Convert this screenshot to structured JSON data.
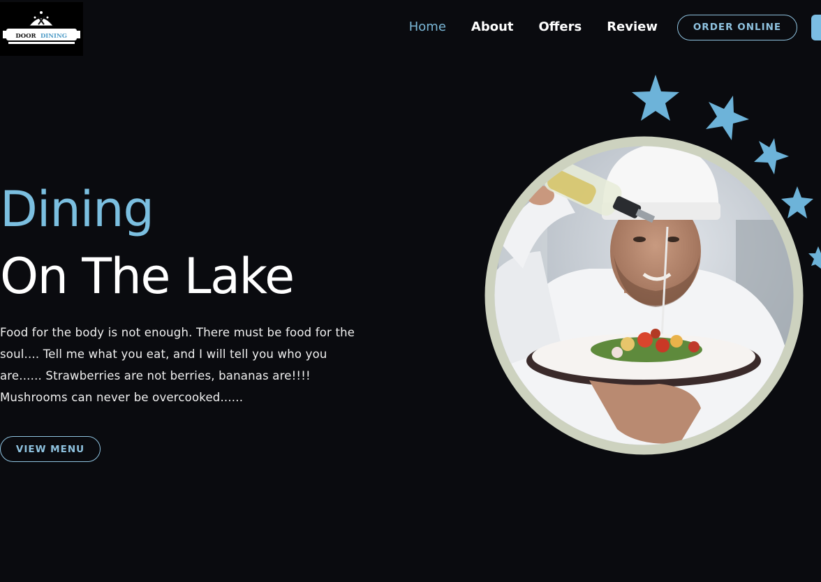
{
  "brand": {
    "logo_text_1": "DOOR",
    "logo_text_2": "DINING"
  },
  "nav": {
    "links": [
      {
        "label": "Home",
        "active": true
      },
      {
        "label": "About",
        "active": false
      },
      {
        "label": "Offers",
        "active": false
      },
      {
        "label": "Review",
        "active": false
      }
    ],
    "order_label": "ORDER ONLINE"
  },
  "hero": {
    "title_line_1": "Dining",
    "title_line_2": "On The Lake",
    "description": "Food for the body is not enough. There must be food for the soul.... Tell me what you eat, and I will tell you who you are...... Strawberries are not berries, bananas are!!!! Mushrooms can never be overcooked......",
    "cta_label": "VIEW MENU"
  },
  "image": {
    "icon": "chef-pouring-oil-photo"
  },
  "colors": {
    "background": "#0a0b0f",
    "accent": "#7bbfe0",
    "ring": "#cdd2bf",
    "text": "#ffffff"
  }
}
